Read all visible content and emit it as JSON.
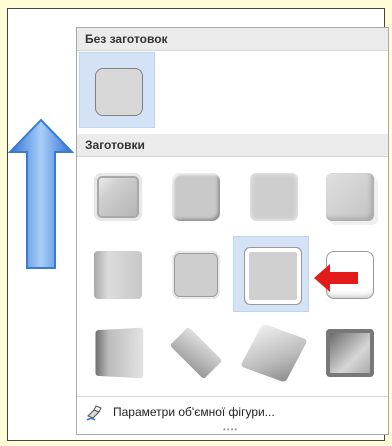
{
  "gallery": {
    "no_presets_header": "Без заготовок",
    "presets_header": "Заготовки",
    "no_preset_item": {
      "icon": "bevel-none-icon",
      "selected": true
    },
    "preset_items": [
      {
        "icon": "bevel-circle-icon"
      },
      {
        "icon": "bevel-relaxed-inset-icon"
      },
      {
        "icon": "bevel-cross-icon"
      },
      {
        "icon": "bevel-cool-slant-icon"
      },
      {
        "icon": "bevel-angle-icon"
      },
      {
        "icon": "bevel-soft-round-icon"
      },
      {
        "icon": "bevel-convex-icon",
        "highlighted": true
      },
      {
        "icon": "bevel-slope-icon"
      },
      {
        "icon": "bevel-divot-icon"
      },
      {
        "icon": "bevel-riblet-icon"
      },
      {
        "icon": "bevel-hard-edge-icon"
      },
      {
        "icon": "bevel-art-deco-icon"
      }
    ],
    "footer_label": "Параметри об'ємної фігури...",
    "footer_icon": "3d-options-icon",
    "resize_grip": "••••"
  },
  "annotations": {
    "blue_arrow": {
      "direction": "up",
      "color": "#4a8fe0"
    },
    "red_arrow": {
      "direction": "left",
      "color": "#e31b1b"
    }
  },
  "colors": {
    "page_background": "#fffdd8",
    "selection": "#d3e3f5",
    "header_background": "#ebebeb"
  }
}
